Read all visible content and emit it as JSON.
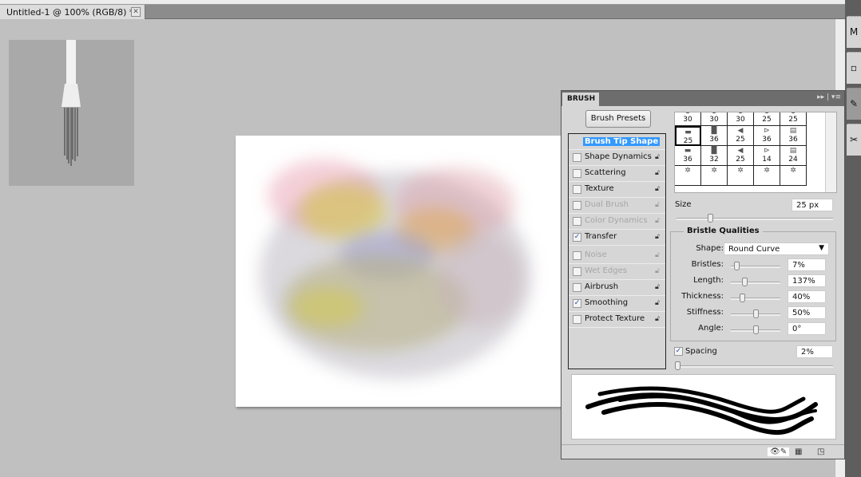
{
  "document": {
    "tab_title": "Untitled-1 @ 100% (RGB/8) *",
    "close_label": "✕"
  },
  "dock": {
    "icons": [
      "mini-bridge-icon",
      "swatches-icon",
      "brush-icon",
      "tools-icon"
    ],
    "mini_label": "M"
  },
  "panel": {
    "tab": "BRUSH",
    "menu_glyphs": "▸▸ | ▾≡",
    "brush_presets": "Brush Presets",
    "options": [
      {
        "label": "Brush Tip Shape",
        "selected": true
      },
      {
        "label": "Shape Dynamics",
        "checked": false,
        "enabled": true
      },
      {
        "label": "Scattering",
        "checked": false,
        "enabled": true
      },
      {
        "label": "Texture",
        "checked": false,
        "enabled": true
      },
      {
        "label": "Dual Brush",
        "checked": false,
        "enabled": false
      },
      {
        "label": "Color Dynamics",
        "checked": false,
        "enabled": false
      },
      {
        "label": "Transfer",
        "checked": true,
        "enabled": true
      },
      {
        "label": "Noise",
        "checked": false,
        "enabled": false
      },
      {
        "label": "Wet Edges",
        "checked": false,
        "enabled": false
      },
      {
        "label": "Airbrush",
        "checked": false,
        "enabled": true
      },
      {
        "label": "Smoothing",
        "checked": true,
        "enabled": true
      },
      {
        "label": "Protect Texture",
        "checked": false,
        "enabled": true
      }
    ],
    "brush_grid": [
      [
        "30",
        "30",
        "30",
        "25",
        "25"
      ],
      [
        "25",
        "36",
        "25",
        "36",
        "36"
      ],
      [
        "36",
        "32",
        "25",
        "14",
        "24"
      ],
      [
        "",
        "",
        "",
        "",
        ""
      ]
    ],
    "size": {
      "label": "Size",
      "value": "25 px",
      "fraction": 0.2
    },
    "bristle": {
      "title": "Bristle Qualities",
      "shape_label": "Shape:",
      "shape_value": "Round Curve",
      "sliders": [
        {
          "label": "Bristles:",
          "value": "7%",
          "fraction": 0.07
        },
        {
          "label": "Length:",
          "value": "137%",
          "fraction": 0.25
        },
        {
          "label": "Thickness:",
          "value": "40%",
          "fraction": 0.2
        },
        {
          "label": "Stiffness:",
          "value": "50%",
          "fraction": 0.5
        },
        {
          "label": "Angle:",
          "value": "0°",
          "fraction": 0.5
        }
      ]
    },
    "spacing": {
      "label": "Spacing",
      "checked": true,
      "value": "2%",
      "fraction": 0.0
    }
  }
}
